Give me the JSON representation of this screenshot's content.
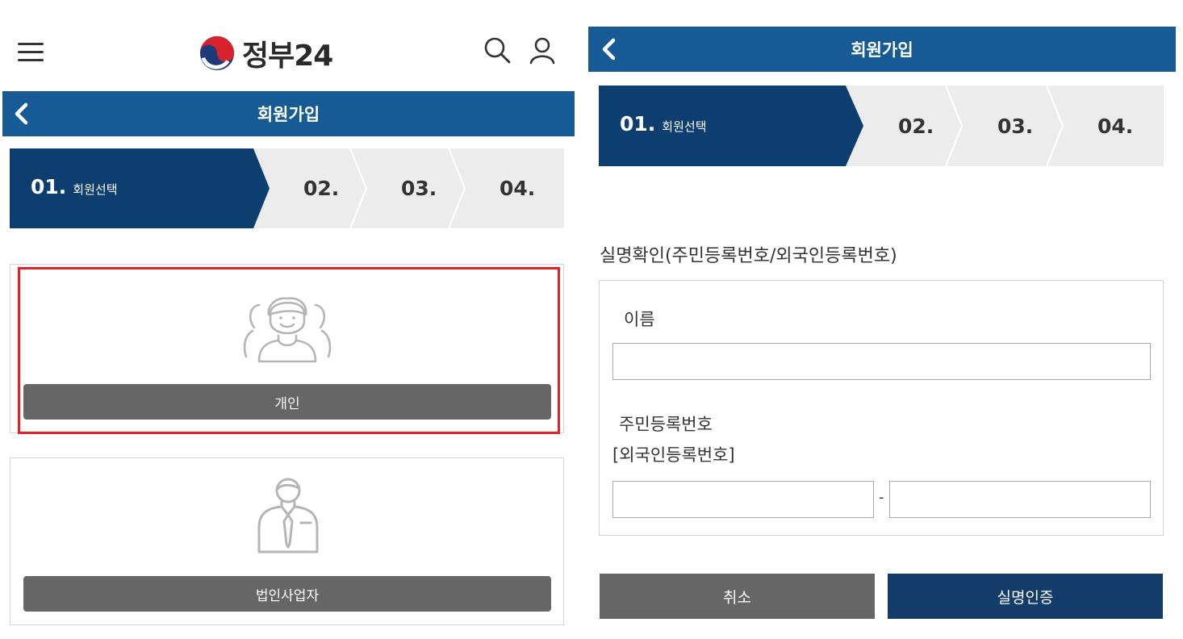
{
  "app": {
    "logo_text": "정부24"
  },
  "left": {
    "header_title": "회원가입",
    "steps": [
      {
        "num": "01.",
        "label": "회원선택"
      },
      {
        "num": "02."
      },
      {
        "num": "03."
      },
      {
        "num": "04."
      }
    ],
    "cards": [
      {
        "button_label": "개인",
        "icon": "people-group-icon",
        "selected": true
      },
      {
        "button_label": "법인사업자",
        "icon": "businessman-icon",
        "selected": false
      }
    ]
  },
  "right": {
    "header_title": "회원가입",
    "steps": [
      {
        "num": "01.",
        "label": "회원선택"
      },
      {
        "num": "02."
      },
      {
        "num": "03."
      },
      {
        "num": "04."
      }
    ],
    "section_title": "실명확인(주민등록번호/외국인등록번호)",
    "form": {
      "name_label": "이름",
      "name_value": "",
      "rrn_label_line1": "주민등록번호",
      "rrn_label_line2": "[외국인등록번호]",
      "rrn_front_value": "",
      "rrn_separator": "-",
      "rrn_back_value": ""
    },
    "buttons": {
      "cancel": "취소",
      "verify": "실명인증"
    }
  },
  "colors": {
    "header_blue": "#165a96",
    "step_active": "#0c3e70",
    "button_gray": "#666666",
    "button_navy": "#133c6a",
    "highlight_red": "#e4202a"
  }
}
